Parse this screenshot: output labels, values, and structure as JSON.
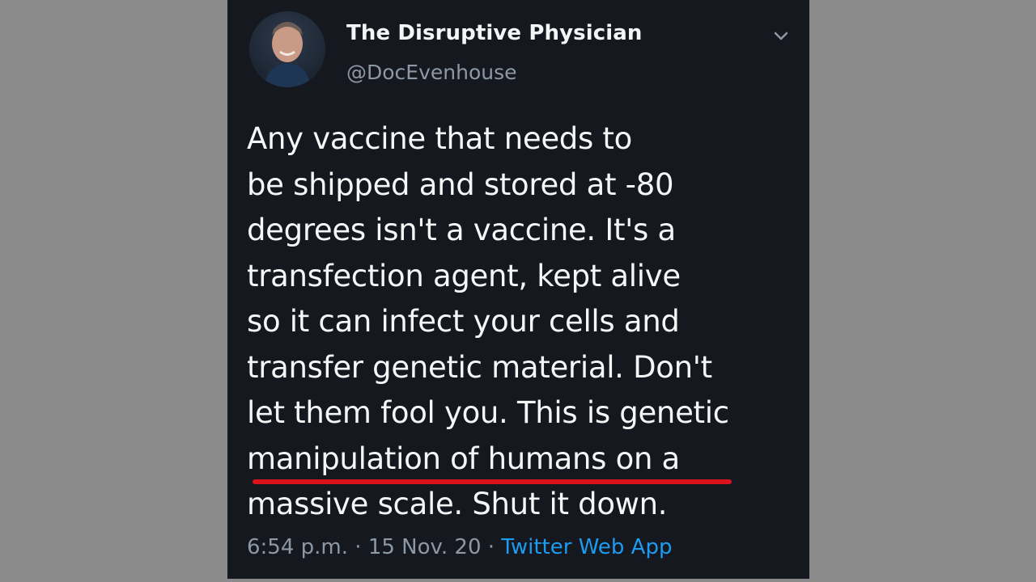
{
  "tweet": {
    "display_name": "The Disruptive Physician",
    "handle": "@DocEvenhouse",
    "lines": [
      "Any vaccine that needs to",
      "be shipped and stored at -80",
      "degrees isn't a vaccine. It's a",
      "transfection agent, kept alive",
      "so it can infect your cells and",
      "transfer genetic material. Don't",
      "let them fool you. This is genetic",
      "manipulation of humans on a",
      "massive scale. Shut it down."
    ],
    "time": "6:54 p.m.",
    "separator": "·",
    "date": "15 Nov. 20",
    "source": "Twitter Web App"
  },
  "icons": {
    "menu": "chevron-down-icon",
    "avatar": "avatar-photo"
  },
  "colors": {
    "background": "#15191f",
    "text": "#f4f6f8",
    "muted": "#8d98a6",
    "link": "#1d9bf0",
    "underline": "#d9131c"
  }
}
